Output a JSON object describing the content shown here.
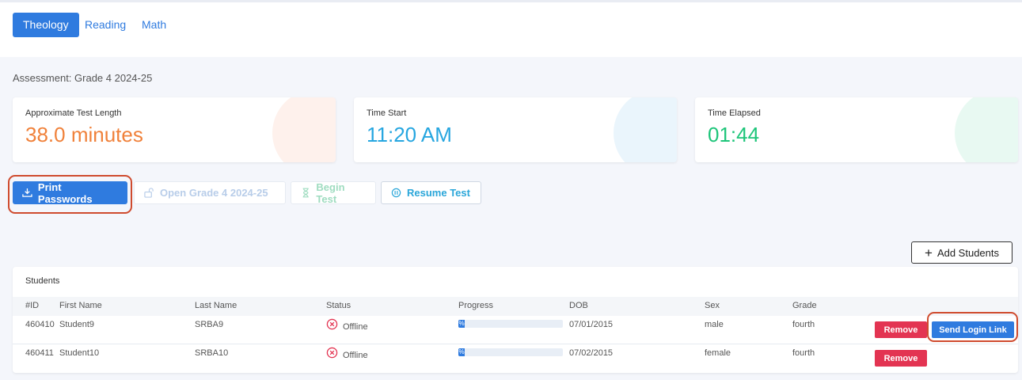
{
  "tabs": [
    {
      "label": "Theology",
      "active": true
    },
    {
      "label": "Reading",
      "active": false
    },
    {
      "label": "Math",
      "active": false
    }
  ],
  "assessment_label": "Assessment: Grade 4 2024-25",
  "cards": {
    "test_length": {
      "label": "Approximate Test Length",
      "value": "38.0 minutes",
      "color": "#f0813a"
    },
    "time_start": {
      "label": "Time Start",
      "value": "11:20 AM",
      "color": "#26a6e0"
    },
    "time_elapsed": {
      "label": "Time Elapsed",
      "value": "01:44",
      "color": "#1ec57a"
    }
  },
  "actions": {
    "print_passwords": "Print Passwords",
    "open_assessment": "Open Grade 4 2024-25",
    "begin_test": "Begin Test",
    "resume_test": "Resume Test",
    "add_students": "Add Students"
  },
  "students": {
    "title": "Students",
    "columns": [
      "#ID",
      "First Name",
      "Last Name",
      "Status",
      "Progress",
      "DOB",
      "Sex",
      "Grade"
    ],
    "rows": [
      {
        "id": "460410",
        "first": "Student9",
        "last": "SRBA9",
        "status": "Offline",
        "progress_label": "%",
        "progress": 0,
        "dob": "07/01/2015",
        "sex": "male",
        "grade": "fourth",
        "remove": "Remove",
        "send": "Send Login Link"
      },
      {
        "id": "460411",
        "first": "Student10",
        "last": "SRBA10",
        "status": "Offline",
        "progress_label": "%",
        "progress": 0,
        "dob": "07/02/2015",
        "sex": "female",
        "grade": "fourth",
        "remove": "Remove"
      }
    ]
  },
  "colors": {
    "accent": "#2f7bdf",
    "danger": "#e33452",
    "highlight": "#cf4b2e"
  }
}
